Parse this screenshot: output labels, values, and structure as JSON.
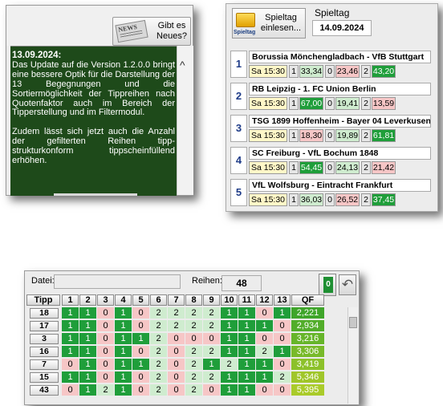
{
  "news": {
    "button_label": "Gibt es\nNeues?",
    "date": "13.09.2024:",
    "paragraph1": "Das Update auf die Version 1.2.0.0 bringt eine bessere Optik für die Darstellung der 13 Begegnungen und die Sortiermöglichkeit der Tippreihen nach Quotenfaktor auch im Bereich der Tipperstellung und im Filtermodul.",
    "paragraph2": "Zudem lässt sich jetzt auch die Anzahl der gefilterten Reihen tipp-strukturkonform tippscheinfüllend erhöhen.",
    "scroll_up": "^"
  },
  "spieltag": {
    "load_button": "Spieltag\neinlesen...",
    "folder_label": "Spieltag",
    "heading": "Spieltag",
    "date": "14.09.2024",
    "matches": [
      {
        "n": "1",
        "title": "Borussia Mönchengladbach - VfB Stuttgart",
        "time": "Sa 15:30",
        "o1": "33,34",
        "o0": "23,46",
        "o2": "43,20",
        "c1": "lgreen",
        "c0": "pink",
        "c2": "green"
      },
      {
        "n": "2",
        "title": "RB Leipzig - 1. FC Union Berlin",
        "time": "Sa 15:30",
        "o1": "67,00",
        "o0": "19,41",
        "o2": "13,59",
        "c1": "green",
        "c0": "lgreen",
        "c2": "pink"
      },
      {
        "n": "3",
        "title": "TSG 1899 Hoffenheim - Bayer 04 Leverkusen",
        "time": "Sa 15:30",
        "o1": "18,30",
        "o0": "19,89",
        "o2": "61,81",
        "c1": "pink",
        "c0": "lgreen",
        "c2": "green"
      },
      {
        "n": "4",
        "title": "SC Freiburg - VfL Bochum 1848",
        "time": "Sa 15:30",
        "o1": "54,45",
        "o0": "24,13",
        "o2": "21,42",
        "c1": "green",
        "c0": "lgreen",
        "c2": "pink"
      },
      {
        "n": "5",
        "title": "VfL Wolfsburg - Eintracht Frankfurt",
        "time": "Sa 15:30",
        "o1": "36,03",
        "o0": "26,52",
        "o2": "37,45",
        "c1": "lgreen",
        "c0": "pink",
        "c2": "green"
      }
    ],
    "labels": {
      "one": "1",
      "zero": "0",
      "two": "2"
    }
  },
  "tipp": {
    "datei_label": "Datei:",
    "reihen_label": "Reihen:",
    "reihen_value": "48",
    "btn1_text": "0",
    "btn2_icon": "undo-icon",
    "headers": [
      "Tipp",
      "1",
      "2",
      "3",
      "4",
      "5",
      "6",
      "7",
      "8",
      "9",
      "10",
      "11",
      "12",
      "13",
      "QF"
    ],
    "rows": [
      {
        "tipp": "18",
        "vals": [
          "1",
          "1",
          "0",
          "1",
          "0",
          "2",
          "2",
          "2",
          "2",
          "1",
          "1",
          "0",
          "1"
        ],
        "qf": "2,221"
      },
      {
        "tipp": "17",
        "vals": [
          "1",
          "1",
          "0",
          "1",
          "0",
          "2",
          "2",
          "2",
          "2",
          "1",
          "1",
          "1",
          "0"
        ],
        "qf": "2,934"
      },
      {
        "tipp": "3",
        "vals": [
          "1",
          "1",
          "0",
          "1",
          "1",
          "2",
          "0",
          "0",
          "0",
          "1",
          "1",
          "0",
          "0"
        ],
        "qf": "3,216"
      },
      {
        "tipp": "16",
        "vals": [
          "1",
          "1",
          "0",
          "1",
          "0",
          "2",
          "0",
          "2",
          "2",
          "1",
          "1",
          "2",
          "1"
        ],
        "qf": "3,306"
      },
      {
        "tipp": "7",
        "vals": [
          "0",
          "1",
          "0",
          "1",
          "1",
          "2",
          "0",
          "2",
          "1",
          "2",
          "1",
          "1",
          "0"
        ],
        "qf": "3,419"
      },
      {
        "tipp": "15",
        "vals": [
          "1",
          "1",
          "0",
          "1",
          "0",
          "2",
          "0",
          "2",
          "2",
          "1",
          "1",
          "1",
          "2"
        ],
        "qf": "5,346"
      },
      {
        "tipp": "43",
        "vals": [
          "0",
          "1",
          "2",
          "1",
          "0",
          "2",
          "0",
          "2",
          "0",
          "1",
          "1",
          "0",
          "0"
        ],
        "qf": "5,395"
      }
    ]
  }
}
